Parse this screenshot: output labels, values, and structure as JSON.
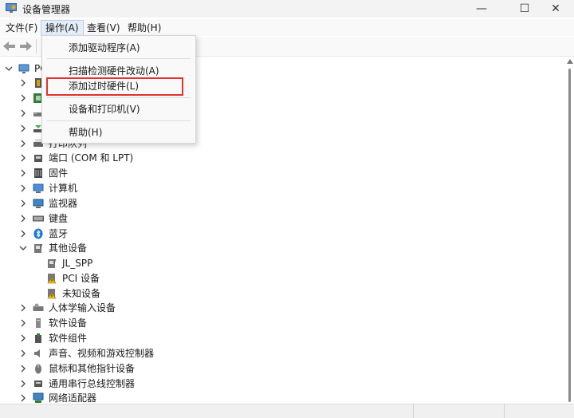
{
  "window": {
    "title": "设备管理器",
    "minimize": "—",
    "maximize": "☐",
    "close": "✕"
  },
  "menubar": [
    {
      "label": "文件(F)"
    },
    {
      "label": "操作(A)"
    },
    {
      "label": "查看(V)"
    },
    {
      "label": "帮助(H)"
    }
  ],
  "dropdown": {
    "items": [
      {
        "label": "添加驱动程序(A)"
      },
      {
        "label": "扫描检测硬件改动(A)"
      },
      {
        "label": "添加过时硬件(L)"
      },
      {
        "label": "设备和打印机(V)"
      },
      {
        "label": "帮助(H)"
      }
    ]
  },
  "tree": {
    "root": {
      "label": "PC"
    },
    "categories": [
      {
        "label": ""
      },
      {
        "label": ""
      },
      {
        "label": ""
      },
      {
        "label": ""
      },
      {
        "label": "打印队列"
      },
      {
        "label": "端口 (COM 和 LPT)"
      },
      {
        "label": "固件"
      },
      {
        "label": "计算机"
      },
      {
        "label": "监视器"
      },
      {
        "label": "键盘"
      },
      {
        "label": "蓝牙"
      },
      {
        "label": "其他设备"
      },
      {
        "label": "JL_SPP"
      },
      {
        "label": "PCI 设备"
      },
      {
        "label": "未知设备"
      },
      {
        "label": "人体学输入设备"
      },
      {
        "label": "软件设备"
      },
      {
        "label": "软件组件"
      },
      {
        "label": "声音、视频和游戏控制器"
      },
      {
        "label": "鼠标和其他指针设备"
      },
      {
        "label": "通用串行总线控制器"
      },
      {
        "label": "网络适配器"
      }
    ]
  },
  "colors": {
    "highlight_border": "#e0332e",
    "menu_active": "#e3eefa",
    "bluetooth": "#1877d6"
  }
}
